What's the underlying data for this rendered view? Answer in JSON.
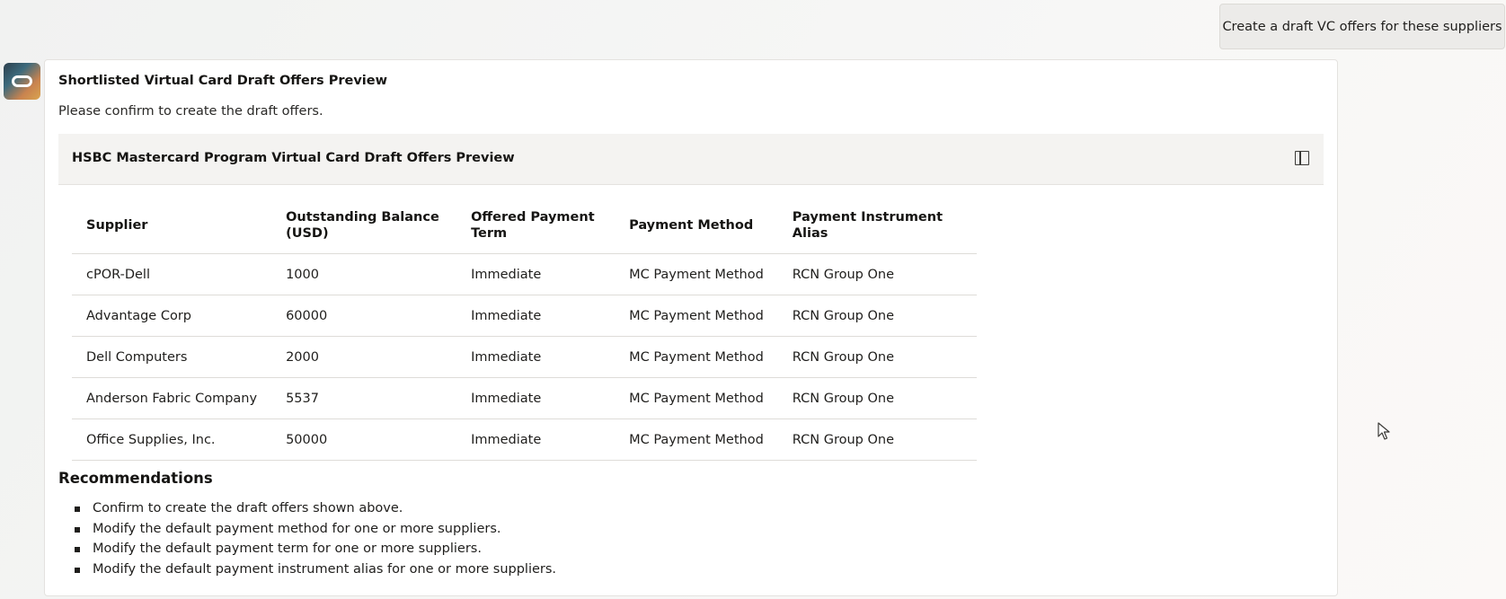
{
  "user_message": "Create a draft VC offers for these suppliers",
  "assistant": {
    "avatar_icon": "oracle-assistant-avatar-icon",
    "title": "Shortlisted Virtual Card Draft Offers Preview",
    "subtitle": "Please confirm to create the draft offers.",
    "panel": {
      "title": "HSBC Mastercard Program Virtual Card Draft Offers Preview",
      "action_icon": "side-panel-icon"
    },
    "table": {
      "columns": [
        "Supplier",
        "Outstanding Balance (USD)",
        "Offered Payment Term",
        "Payment Method",
        "Payment Instrument Alias"
      ],
      "rows": [
        [
          "cPOR-Dell",
          "1000",
          "Immediate",
          "MC Payment Method",
          "RCN Group One"
        ],
        [
          "Advantage Corp",
          "60000",
          "Immediate",
          "MC Payment Method",
          "RCN Group One"
        ],
        [
          "Dell Computers",
          "2000",
          "Immediate",
          "MC Payment Method",
          "RCN Group One"
        ],
        [
          "Anderson Fabric Company",
          "5537",
          "Immediate",
          "MC Payment Method",
          "RCN Group One"
        ],
        [
          "Office Supplies, Inc.",
          "50000",
          "Immediate",
          "MC Payment Method",
          "RCN Group One"
        ]
      ]
    },
    "recommendations": {
      "title": "Recommendations",
      "items": [
        "Confirm to create the draft offers shown above.",
        "Modify the default payment method for one or more suppliers.",
        "Modify the default payment term for one or more suppliers.",
        "Modify the default payment instrument alias for one or more suppliers."
      ]
    }
  },
  "cursor_icon": "mouse-pointer-icon"
}
